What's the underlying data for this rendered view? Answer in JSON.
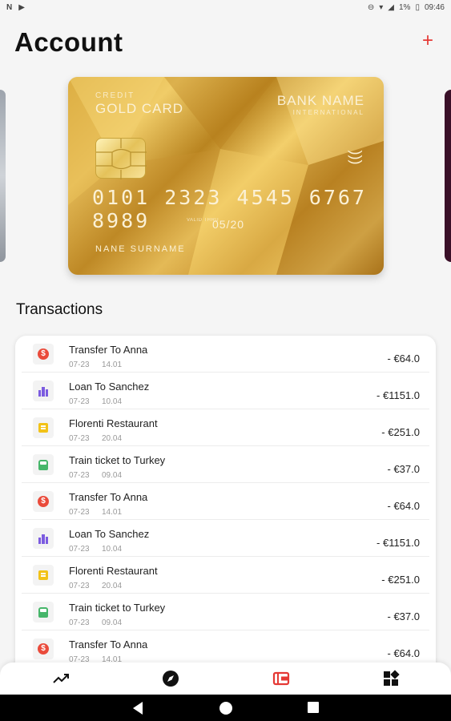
{
  "status_bar": {
    "left_icons": [
      "N",
      "▶"
    ],
    "battery": "1%",
    "time": "09:46"
  },
  "header": {
    "title": "Account",
    "add_label": "+"
  },
  "card": {
    "type_small": "CREDIT",
    "type": "GOLD CARD",
    "bank_name": "BANK NAME",
    "bank_sub": "INTERNATIONAL",
    "number": "0101 2323 4545 6767 8989",
    "valid_label": "VALID THRU",
    "expiry": "05/20",
    "holder": "NANE SURNAME"
  },
  "transactions": {
    "title": "Transactions",
    "items": [
      {
        "icon": "dollar-icon",
        "name": "Transfer To Anna",
        "date": "07-23",
        "time": "14.01",
        "amount": "- €64.0"
      },
      {
        "icon": "city-icon",
        "name": "Loan To Sanchez",
        "date": "07-23",
        "time": "10.04",
        "amount": "- €1151.0"
      },
      {
        "icon": "restaurant-icon",
        "name": "Florenti Restaurant",
        "date": "07-23",
        "time": "20.04",
        "amount": "- €251.0"
      },
      {
        "icon": "train-icon",
        "name": "Train ticket to Turkey",
        "date": "07-23",
        "time": "09.04",
        "amount": "- €37.0"
      },
      {
        "icon": "dollar-icon",
        "name": "Transfer To Anna",
        "date": "07-23",
        "time": "14.01",
        "amount": "- €64.0"
      },
      {
        "icon": "city-icon",
        "name": "Loan To Sanchez",
        "date": "07-23",
        "time": "10.04",
        "amount": "- €1151.0"
      },
      {
        "icon": "restaurant-icon",
        "name": "Florenti Restaurant",
        "date": "07-23",
        "time": "20.04",
        "amount": "- €251.0"
      },
      {
        "icon": "train-icon",
        "name": "Train ticket to Turkey",
        "date": "07-23",
        "time": "09.04",
        "amount": "- €37.0"
      },
      {
        "icon": "dollar-icon",
        "name": "Transfer To Anna",
        "date": "07-23",
        "time": "14.01",
        "amount": "- €64.0"
      }
    ]
  },
  "bottom_nav": {
    "items": [
      "trending-icon",
      "compass-icon",
      "wallet-icon",
      "widgets-icon"
    ],
    "active": "wallet-icon",
    "active_color": "#e53935"
  },
  "colors": {
    "accent": "#e53935",
    "card_gold": "#d8a93a"
  }
}
